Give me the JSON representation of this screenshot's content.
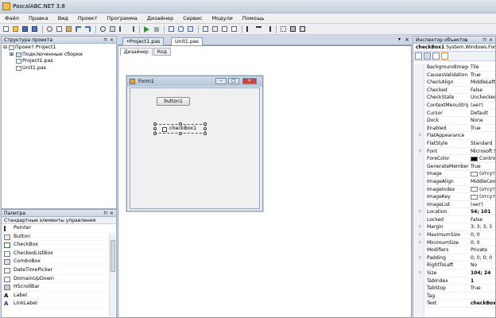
{
  "app": {
    "title": "PascalABC.NET 3.8"
  },
  "menu": [
    "Файл",
    "Правка",
    "Вид",
    "Проект",
    "Программа",
    "Дизайнер",
    "Сервис",
    "Модули",
    "Помощь"
  ],
  "project_panel": {
    "title": "Структура проекта",
    "pin": "⊓",
    "close": "×",
    "tree": [
      {
        "label": "Проект Project1",
        "indent": 0,
        "expander": "⊟"
      },
      {
        "label": "Подключенные сборки",
        "indent": 1,
        "expander": "⊞"
      },
      {
        "label": "Project1.pas",
        "indent": 1,
        "expander": ""
      },
      {
        "label": "Unit1.pas",
        "indent": 1,
        "expander": ""
      }
    ]
  },
  "palette": {
    "title": "Палитра",
    "pin": "⊓",
    "close": "×",
    "category": "Стандартные элементы управления",
    "items": [
      "Pointer",
      "Button",
      "CheckBox",
      "CheckedListBox",
      "ComboBox",
      "DateTimePicker",
      "DomainUpDown",
      "HScrollBar",
      "Label",
      "LinkLabel"
    ]
  },
  "editor": {
    "tabs": [
      "•Project1.pas",
      "Unit1.pas"
    ],
    "active_tab": 1,
    "close": "×",
    "dropdown": "▾",
    "view_tabs": [
      "Дизайнер",
      "Код"
    ],
    "active_view": 0
  },
  "form": {
    "title": "Form1",
    "button_label": "button1",
    "checkbox_label": "checkBox1",
    "min": "–",
    "max": "□",
    "close": "×"
  },
  "inspector": {
    "title": "Инспектор объектов",
    "pin": "⊓",
    "close": "×",
    "object": "checkBox1",
    "object_type": "System.Windows.Forms.CheckBox",
    "properties": [
      {
        "name": "BackgroundImageLayout",
        "value": "Tile"
      },
      {
        "name": "CausesValidation",
        "value": "True"
      },
      {
        "name": "CheckAlign",
        "value": "MiddleLeft"
      },
      {
        "name": "Checked",
        "value": "False"
      },
      {
        "name": "CheckState",
        "value": "Unchecked"
      },
      {
        "name": "ContextMenuStrip",
        "value": "(нет)"
      },
      {
        "name": "Cursor",
        "value": "Default"
      },
      {
        "name": "Dock",
        "value": "None"
      },
      {
        "name": "Enabled",
        "value": "True"
      },
      {
        "name": "FlatAppearance",
        "value": "",
        "expand": true
      },
      {
        "name": "FlatStyle",
        "value": "Standard"
      },
      {
        "name": "Font",
        "value": "Microsoft Sans",
        "expand": true
      },
      {
        "name": "ForeColor",
        "value": "ControlText",
        "swatch": "#000000"
      },
      {
        "name": "GenerateMember",
        "value": "True"
      },
      {
        "name": "Image",
        "value": "(отсутст",
        "swatch": "#ffffff"
      },
      {
        "name": "ImageAlign",
        "value": "MiddleCenter"
      },
      {
        "name": "ImageIndex",
        "value": "(отсутст",
        "swatch": "#ffffff"
      },
      {
        "name": "ImageKey",
        "value": "(отсутст",
        "swatch": "#ffffff"
      },
      {
        "name": "ImageList",
        "value": "(нет)"
      },
      {
        "name": "Location",
        "value": "54; 101",
        "expand": true,
        "bold": true
      },
      {
        "name": "Locked",
        "value": "False"
      },
      {
        "name": "Margin",
        "value": "3; 3; 3; 3",
        "expand": true
      },
      {
        "name": "MaximumSize",
        "value": "0; 0",
        "expand": true
      },
      {
        "name": "MinimumSize",
        "value": "0; 0",
        "expand": true
      },
      {
        "name": "Modifiers",
        "value": "Private"
      },
      {
        "name": "Padding",
        "value": "0; 0; 0; 0",
        "expand": true
      },
      {
        "name": "RightToLeft",
        "value": "No"
      },
      {
        "name": "Size",
        "value": "104; 24",
        "expand": true,
        "bold": true
      },
      {
        "name": "TabIndex",
        "value": "1",
        "bold": true
      },
      {
        "name": "TabStop",
        "value": "True"
      },
      {
        "name": "Tag",
        "value": ""
      },
      {
        "name": "Text",
        "value": "checkBox1",
        "bold": true
      }
    ]
  }
}
